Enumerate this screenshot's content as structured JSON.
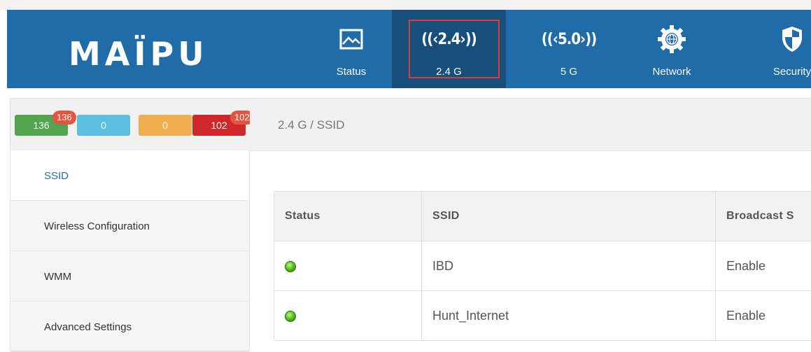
{
  "brand": {
    "logo_text": "MAÏPU"
  },
  "nav": {
    "items": [
      {
        "label": "Status",
        "icon": "picture-icon",
        "active": false
      },
      {
        "label": "2.4 G",
        "icon": "wifi-2.4-icon",
        "glyph": "((‹2.4›))",
        "active": true
      },
      {
        "label": "5 G",
        "icon": "wifi-5.0-icon",
        "glyph": "((‹5.0›))",
        "active": false
      },
      {
        "label": "Network",
        "icon": "globe-gear-icon",
        "active": false
      },
      {
        "label": "Security",
        "icon": "shield-icon",
        "active": false
      }
    ]
  },
  "counts": [
    {
      "value": "136",
      "color": "#52a44f",
      "badge": "136"
    },
    {
      "value": "0",
      "color": "#5bbfe0"
    },
    {
      "value": "0",
      "color": "#f0ad4e"
    },
    {
      "value": "102",
      "color": "#d0282a",
      "badge": "102"
    }
  ],
  "breadcrumb": "2.4 G / SSID",
  "menu": [
    {
      "label": "SSID",
      "active": true
    },
    {
      "label": "Wireless Configuration",
      "active": false
    },
    {
      "label": "WMM",
      "active": false
    },
    {
      "label": "Advanced Settings",
      "active": false
    }
  ],
  "table": {
    "headers": [
      "Status",
      "SSID",
      "Broadcast S"
    ],
    "rows": [
      {
        "status": "green",
        "ssid": "IBD",
        "broadcast": "Enable"
      },
      {
        "status": "green",
        "ssid": "Hunt_Internet",
        "broadcast": "Enable"
      }
    ]
  },
  "colors": {
    "header": "#1f6ca8",
    "active_nav": "#174f7c",
    "highlight_frame": "#e03a3a"
  }
}
